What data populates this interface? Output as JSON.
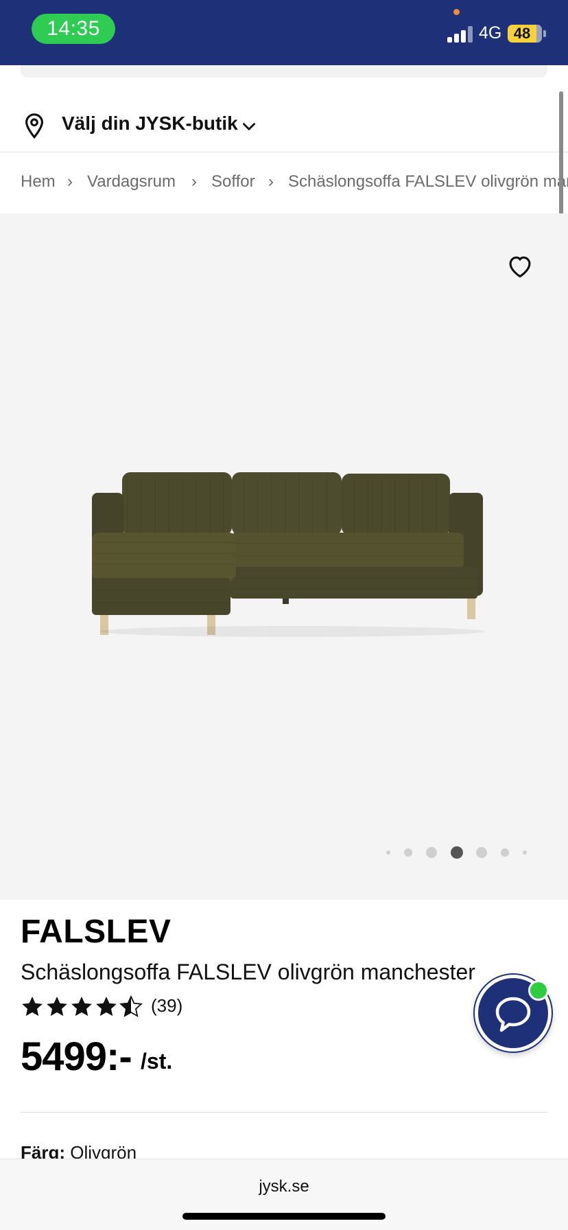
{
  "status_bar": {
    "time": "14:35",
    "network": "4G",
    "battery": "48",
    "colors": {
      "bar": "#1e3178",
      "time_pill": "#2ecc52",
      "battery": "#f7d23a"
    }
  },
  "store_picker": {
    "label": "Välj din JYSK-butik",
    "icon": "location-pin-icon",
    "chevron_icon": "chevron-down-icon"
  },
  "breadcrumb": {
    "items": [
      "Hem",
      "Vardagsrum",
      "Soffor",
      "Schäslongsoffa FALSLEV olivgrön manchester"
    ],
    "separator": "›"
  },
  "gallery": {
    "favorite_icon": "heart-icon",
    "image_alt": "olive green corduroy chaise sofa",
    "dot_count": 7,
    "active_index": 3
  },
  "product": {
    "brand": "FALSLEV",
    "name": "Schäslongsoffa FALSLEV olivgrön manchester",
    "rating": 4.5,
    "review_count": "(39)",
    "price": "5499:-",
    "unit": "/st.",
    "color_label": "Färg:",
    "color_value": "Olivgrön"
  },
  "chat": {
    "icon": "chat-bubble-icon",
    "online": true,
    "colors": {
      "button": "#1e3178",
      "online": "#2ecc40"
    }
  },
  "browser": {
    "url": "jysk.se"
  }
}
